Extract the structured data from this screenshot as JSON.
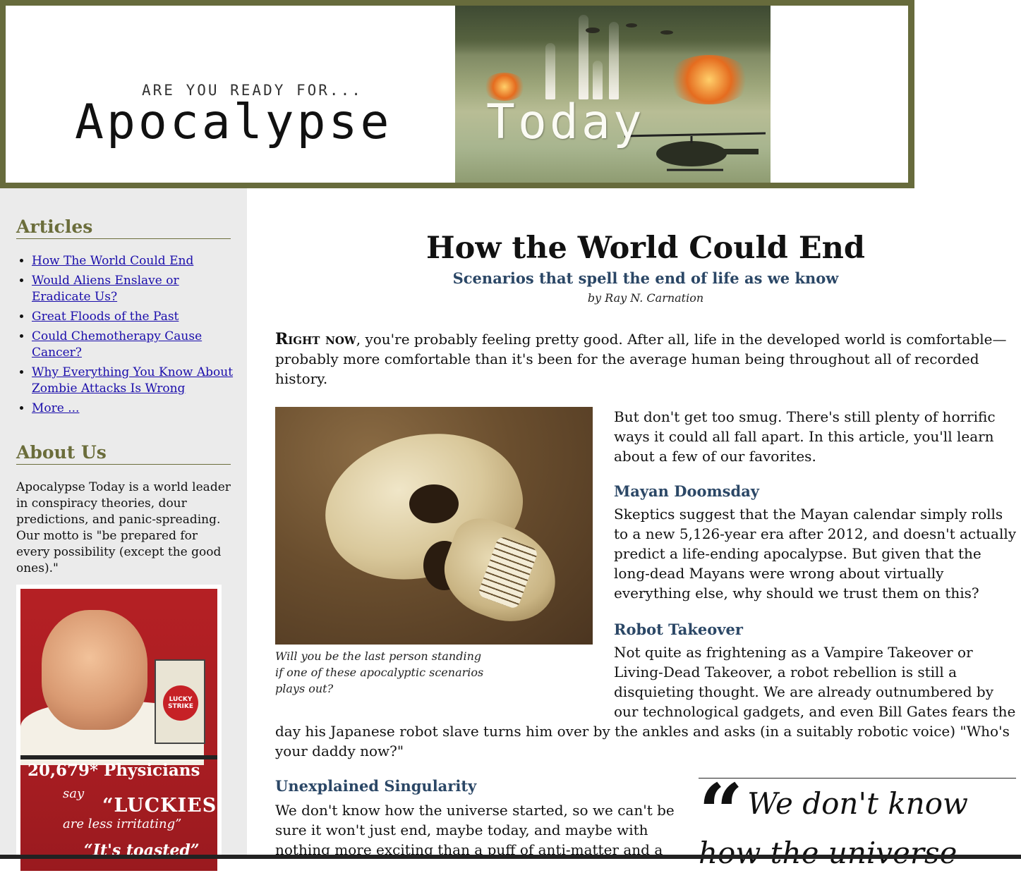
{
  "banner": {
    "tagline": "ARE YOU READY FOR...",
    "logo_word1": "Apocalypse",
    "logo_word2": "Today",
    "frame_color": "#676b3c"
  },
  "sidebar": {
    "articles_heading": "Articles",
    "articles": [
      {
        "label": "How The World Could End"
      },
      {
        "label": "Would Aliens Enslave or Eradicate Us?"
      },
      {
        "label": "Great Floods of the Past"
      },
      {
        "label": "Could Chemotherapy Cause Cancer?"
      },
      {
        "label": "Why Everything You Know About Zombie Attacks Is Wrong"
      },
      {
        "label": "More ..."
      }
    ],
    "about_heading": "About Us",
    "about_text": "Apocalypse Today is a world leader in conspiracy theories, dour predictions, and panic-spreading. Our motto is \"be prepared for every possibility (except the good ones).\"",
    "ad": {
      "pack_text": "LUCKY STRIKE",
      "line1": "20,679* Physicians",
      "line2": "say",
      "line3": "“LUCKIES",
      "line4": "are less irritating”",
      "line5": "“It's toasted”"
    },
    "heading_color": "#6b6d3b",
    "background": "#ebebeb"
  },
  "article": {
    "title": "How the World Could End",
    "subtitle": "Scenarios that spell the end of life as we know",
    "byline": "by Ray N. Carnation",
    "intro_lead": "Right now",
    "intro_rest": ", you're probably feeling pretty good. After all, life in the developed world is comfortable—probably more comfortable than it's been for the average human being throughout all of recorded history.",
    "image_caption": "Will you be the last person standing if one of these apocalyptic scenarios plays out?",
    "para1": "But don't get too smug. There's still plenty of horrific ways it could all fall apart. In this article, you'll learn about a few of our favorites.",
    "sections": [
      {
        "heading": "Mayan Doomsday",
        "text": "Skeptics suggest that the Mayan calendar simply rolls to a new 5,126-year era after 2012, and doesn't actually predict a life-ending apocalypse. But given that the long-dead Mayans were wrong about virtually everything else, why should we trust them on this?"
      },
      {
        "heading": "Robot Takeover",
        "text": "Not quite as frightening as a Vampire Takeover or Living-Dead Takeover, a robot rebellion is still a disquieting thought. We are already outnumbered by our technological gadgets, and even Bill Gates fears the",
        "text_cont": "day his Japanese robot slave turns him over by the ankles and asks (in a suitably robotic voice) \"Who's your daddy now?\""
      },
      {
        "heading": "Unexplained Singularity",
        "text": "We don't know how the universe started, so we can't be sure it won't just end, maybe today, and maybe with nothing more exciting than a puff of anti-matter and a"
      }
    ],
    "pull_quote": "We don't know how the universe",
    "heading_color": "#2b4766"
  }
}
